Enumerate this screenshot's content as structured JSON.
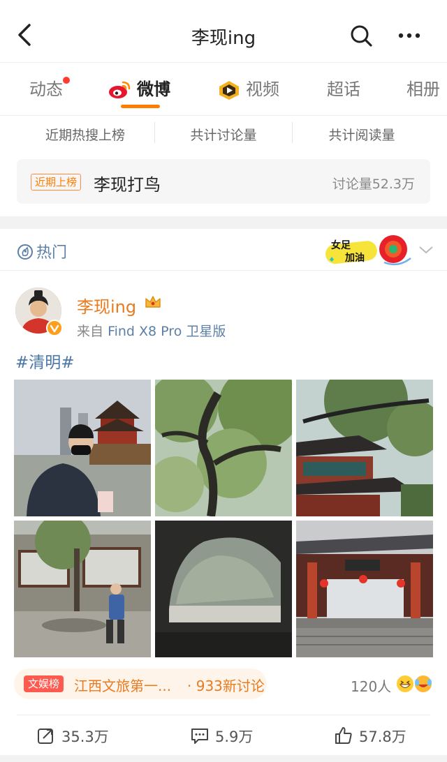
{
  "header": {
    "title": "李现ing"
  },
  "tabs": [
    {
      "label": "动态",
      "has_dot": true
    },
    {
      "label": "微博",
      "active": true
    },
    {
      "label": "视频"
    },
    {
      "label": "超话"
    },
    {
      "label": "相册"
    }
  ],
  "stats_row": {
    "items": [
      "近期热搜上榜",
      "共计讨论量",
      "共计阅读量"
    ]
  },
  "rank": {
    "tag": "近期上榜",
    "title": "李现打鸟",
    "count": "讨论量52.3万"
  },
  "hot": {
    "label": "热门",
    "cheer_line1": "女足",
    "cheer_line2": "加油"
  },
  "post": {
    "username": "李现ing",
    "source_prefix": "来自",
    "device": "Find X8 Pro 卫星版",
    "topic": "#清明#",
    "trend_badge": "文娱榜",
    "trend_text": "江西文旅第一...",
    "trend_count": "· 933新讨论",
    "reaction_count": "120人",
    "actions": {
      "repost": "35.3万",
      "comment": "5.9万",
      "like": "57.8万"
    }
  },
  "colors": {
    "accent": "#ff7e00",
    "link": "#4a76a8",
    "username": "#e87b20",
    "badge_red": "#ff5a4f"
  },
  "icons": [
    "back-icon",
    "search-icon",
    "more-icon",
    "weibo-logo-icon",
    "video-icon",
    "hot-icon",
    "chevron-down-icon",
    "crown-icon",
    "verified-badge-icon",
    "repost-icon",
    "comment-icon",
    "like-icon"
  ]
}
